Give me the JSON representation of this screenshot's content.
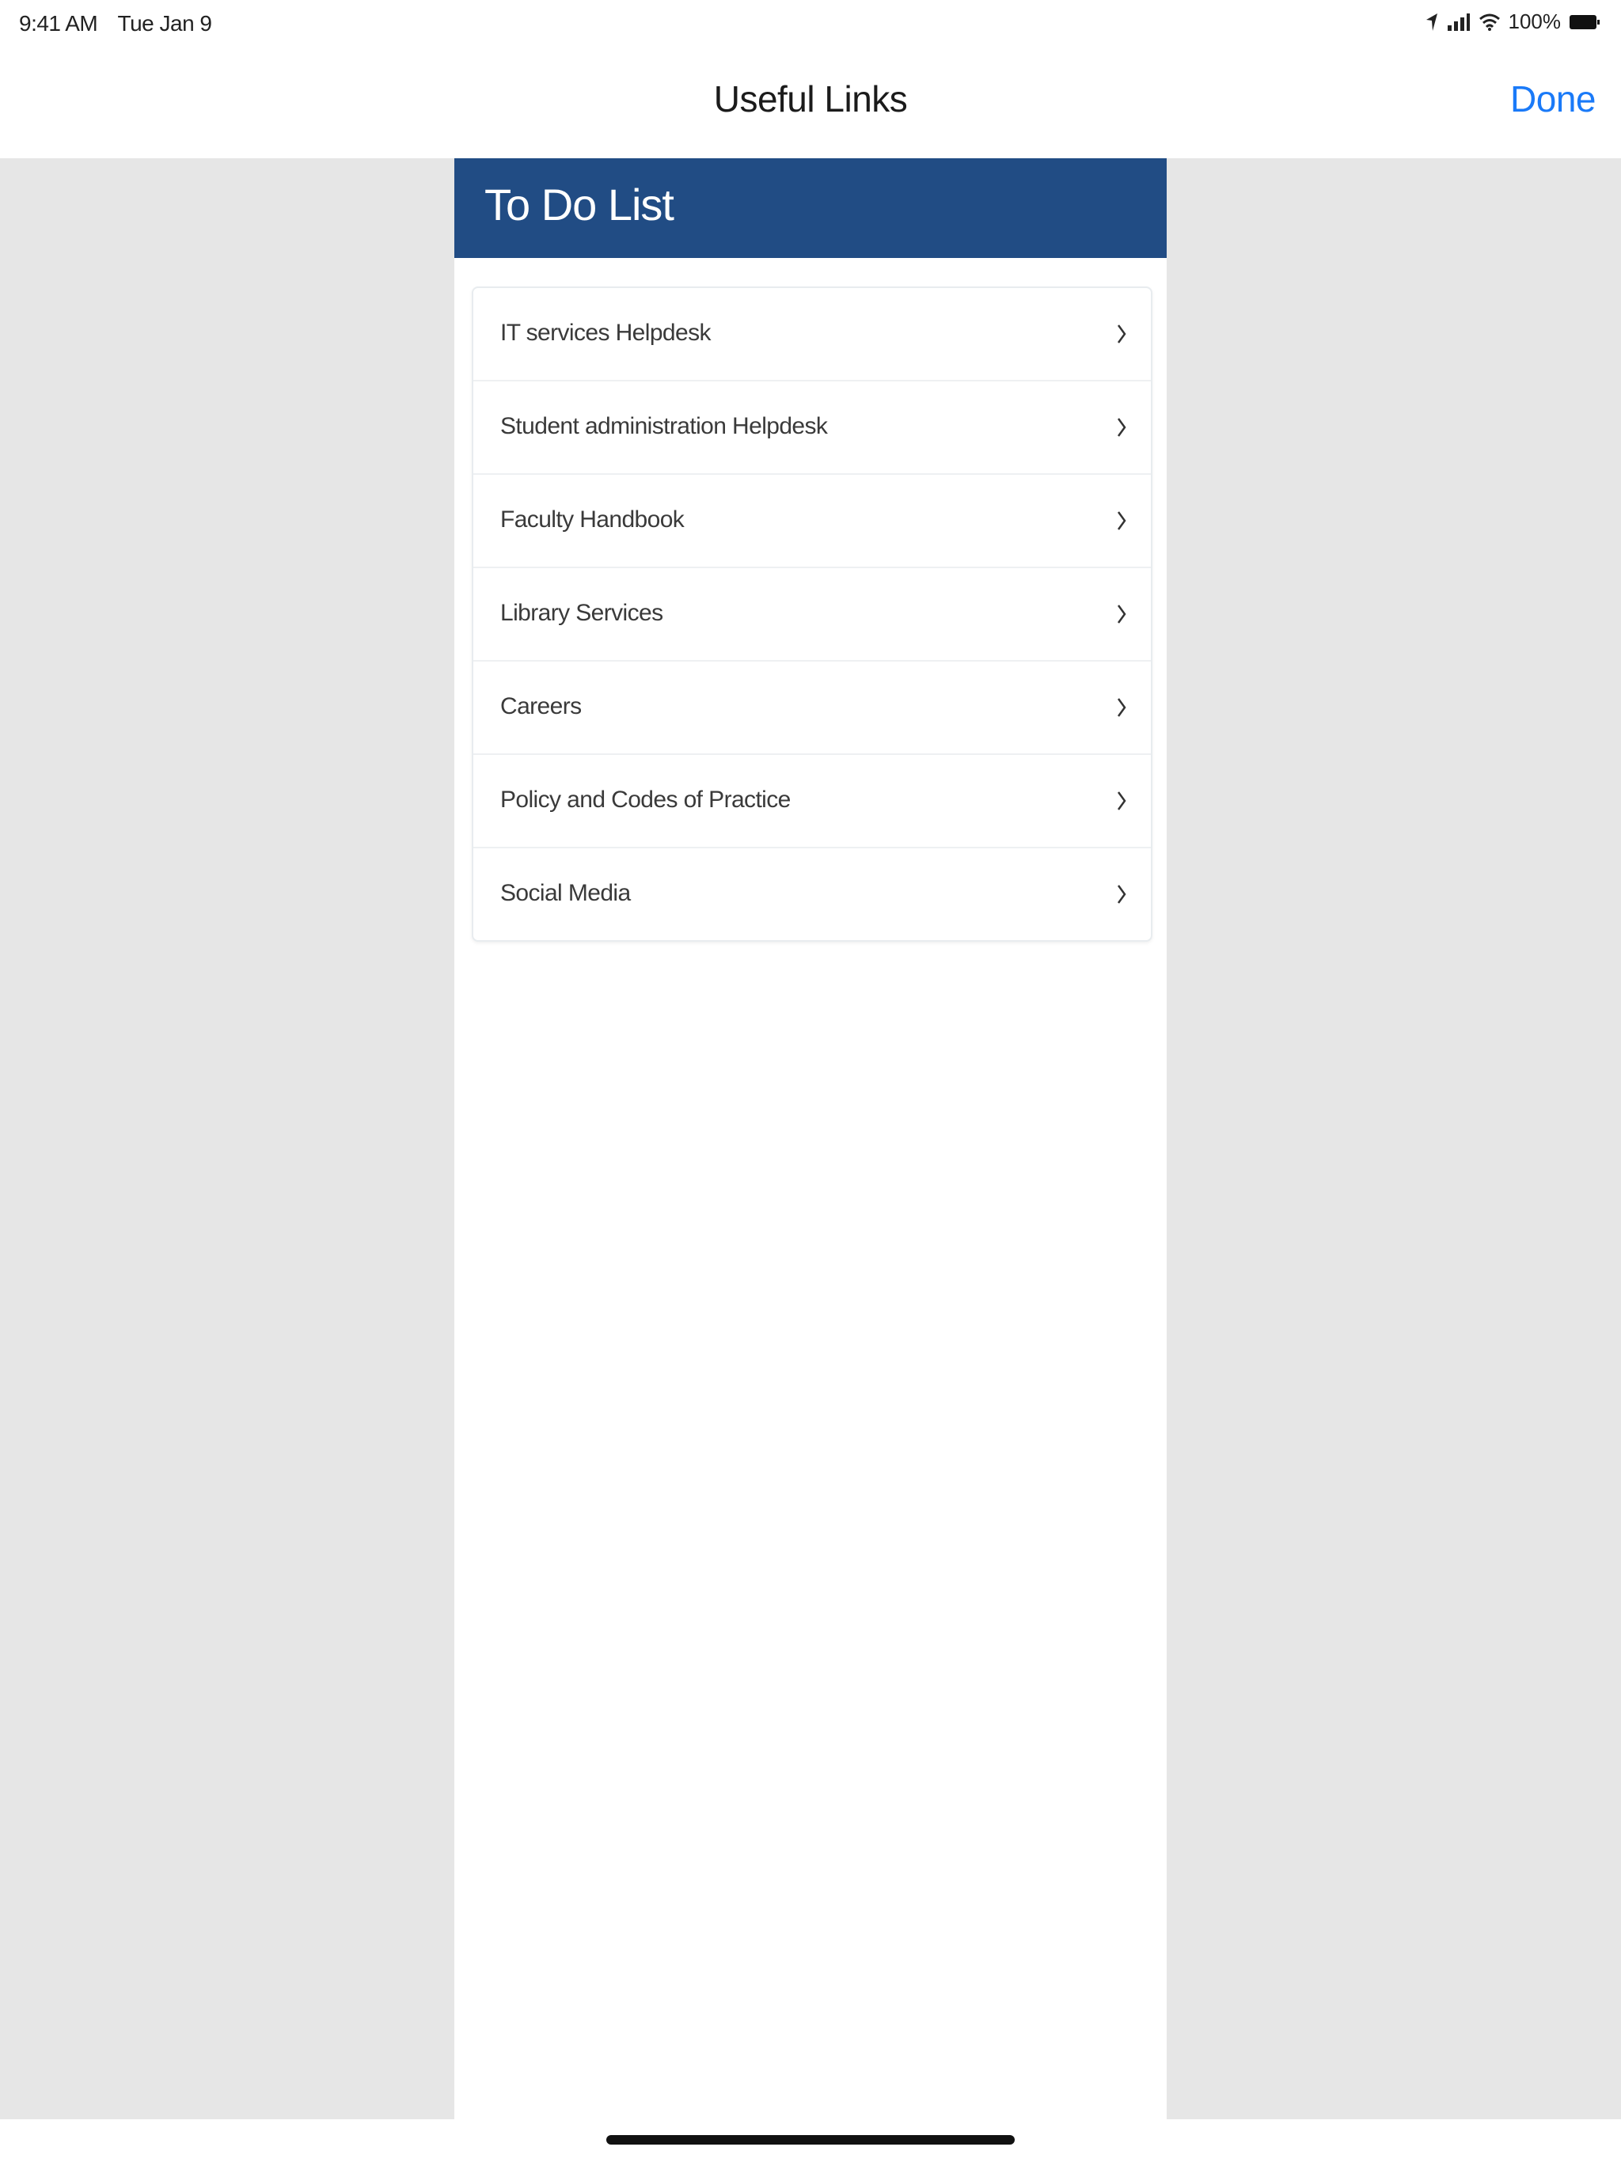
{
  "status_bar": {
    "time": "9:41 AM",
    "date": "Tue Jan 9",
    "battery": "100%",
    "icons": [
      "location-arrow-icon",
      "signal-icon",
      "wifi-icon",
      "battery-icon"
    ]
  },
  "nav": {
    "title": "Useful Links",
    "done_label": "Done"
  },
  "panel": {
    "title": "To Do List",
    "links": [
      {
        "label": "IT services Helpdesk",
        "icon": "chevron-right-icon"
      },
      {
        "label": "Student administration Helpdesk",
        "icon": "chevron-right-icon"
      },
      {
        "label": "Faculty Handbook",
        "icon": "chevron-right-icon"
      },
      {
        "label": "Library Services",
        "icon": "chevron-right-icon"
      },
      {
        "label": "Careers",
        "icon": "chevron-right-icon"
      },
      {
        "label": "Policy and Codes of Practice",
        "icon": "chevron-right-icon"
      },
      {
        "label": "Social Media",
        "icon": "chevron-right-icon"
      }
    ]
  },
  "colors": {
    "header_blue": "#214c84",
    "accent_blue": "#1a7af8",
    "background_gray": "#e6e6e6"
  }
}
